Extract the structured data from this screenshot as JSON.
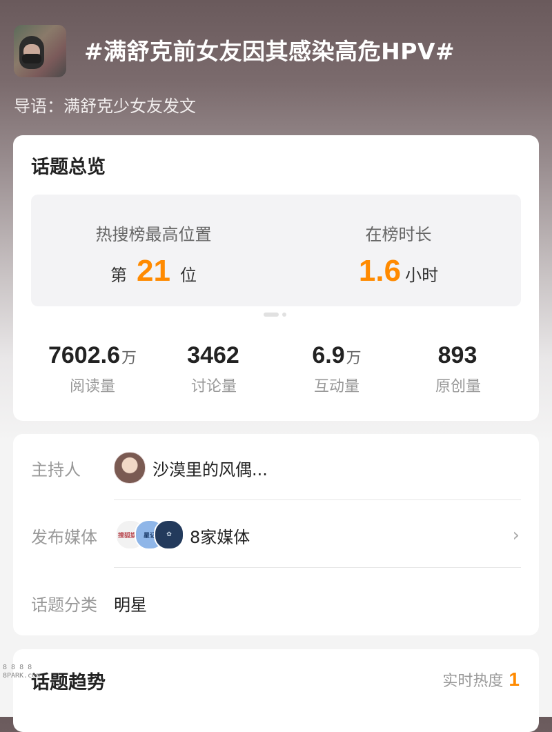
{
  "header": {
    "title": "#满舒克前女友因其感染高危HPV#",
    "intro": "导语：满舒克少女友发文"
  },
  "overview": {
    "title": "话题总览",
    "rank": {
      "label": "热搜榜最高位置",
      "prefix": "第",
      "value": "21",
      "suffix": "位"
    },
    "duration": {
      "label": "在榜时长",
      "value": "1.6",
      "unit": "小时"
    },
    "stats": [
      {
        "value": "7602.6",
        "unit": "万",
        "label": "阅读量"
      },
      {
        "value": "3462",
        "unit": "",
        "label": "讨论量"
      },
      {
        "value": "6.9",
        "unit": "万",
        "label": "互动量"
      },
      {
        "value": "893",
        "unit": "",
        "label": "原创量"
      }
    ]
  },
  "info": {
    "host_label": "主持人",
    "host_name": "沙漠里的风偶...",
    "media_label": "发布媒体",
    "media_icons": [
      "搜狐娱乐",
      "星记",
      "✿"
    ],
    "media_text": "8家媒体",
    "category_label": "话题分类",
    "category_value": "明星"
  },
  "trend": {
    "title": "话题趋势",
    "heat_label": "实时热度",
    "heat_value": "1"
  },
  "watermark": "8 8 8 8\n8PARK.com",
  "colors": {
    "accent": "#ff8a00",
    "card": "#ffffff",
    "muted_text": "#999999"
  }
}
